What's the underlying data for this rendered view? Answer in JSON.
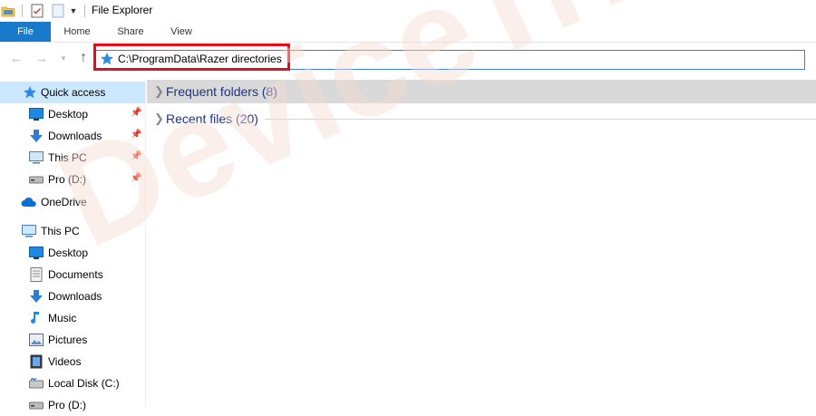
{
  "window": {
    "title": "File Explorer"
  },
  "ribbon": {
    "tabs": [
      {
        "label": "File"
      },
      {
        "label": "Home"
      },
      {
        "label": "Share"
      },
      {
        "label": "View"
      }
    ]
  },
  "address": {
    "path": "C:\\ProgramData\\Razer directories",
    "icon": "quick-access-star-icon"
  },
  "sidebar": {
    "items": [
      {
        "label": "Quick access",
        "icon": "star-icon",
        "pinned": false
      },
      {
        "label": "Desktop",
        "icon": "desktop-icon",
        "pinned": true
      },
      {
        "label": "Downloads",
        "icon": "download-icon",
        "pinned": true
      },
      {
        "label": "This PC",
        "icon": "computer-icon",
        "pinned": true
      },
      {
        "label": "Pro (D:)",
        "icon": "drive-icon",
        "pinned": true
      },
      {
        "label": "OneDrive",
        "icon": "cloud-icon",
        "pinned": false
      },
      {
        "label": "This PC",
        "icon": "computer-icon",
        "pinned": false
      },
      {
        "label": "Desktop",
        "icon": "desktop-icon",
        "pinned": false
      },
      {
        "label": "Documents",
        "icon": "document-icon",
        "pinned": false
      },
      {
        "label": "Downloads",
        "icon": "download-icon",
        "pinned": false
      },
      {
        "label": "Music",
        "icon": "music-icon",
        "pinned": false
      },
      {
        "label": "Pictures",
        "icon": "pictures-icon",
        "pinned": false
      },
      {
        "label": "Videos",
        "icon": "video-icon",
        "pinned": false
      },
      {
        "label": "Local Disk (C:)",
        "icon": "disk-icon",
        "pinned": false
      },
      {
        "label": "Pro (D:)",
        "icon": "drive-icon",
        "pinned": false
      }
    ]
  },
  "main": {
    "groups": [
      {
        "title": "Frequent folders (8)"
      },
      {
        "title": "Recent files (20)"
      }
    ]
  },
  "watermark": {
    "text": "DeviceTricks"
  },
  "colors": {
    "accent": "#1979ca",
    "selection": "#cce8ff",
    "highlight_border": "#e10e1b",
    "group_title": "#1e3287"
  }
}
